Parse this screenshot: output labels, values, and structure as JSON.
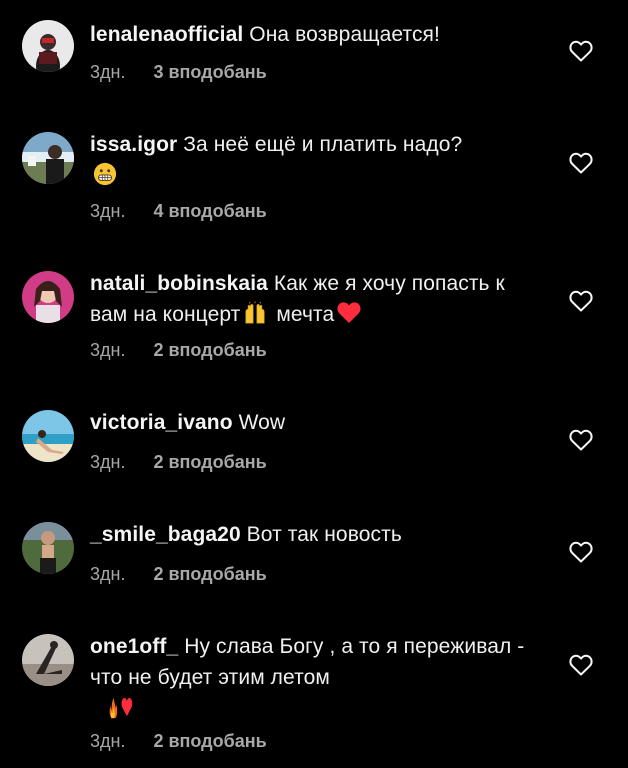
{
  "comments": [
    {
      "username": "lenalenaofficial",
      "text": "Она возвращается!",
      "time": "3дн.",
      "likes": "3 вподобань",
      "avatar_icon": "user-avatar-icon"
    },
    {
      "username": "issa.igor",
      "text": "За неё ещё и платить надо?",
      "emoji_after": "grimacing-face-emoji",
      "time": "3дн.",
      "likes": "4 вподобань",
      "avatar_icon": "user-avatar-icon"
    },
    {
      "username": "natali_bobinskaia",
      "text": "Как же я хочу попасть к вам на концерт",
      "text_after": " мечта",
      "emoji_inline": "raising-hands-emoji",
      "emoji_after": "red-heart-emoji",
      "time": "3дн.",
      "likes": "2 вподобань",
      "avatar_icon": "user-avatar-icon"
    },
    {
      "username": "victoria_ivano",
      "text": "Wow",
      "time": "3дн.",
      "likes": "2 вподобань",
      "avatar_icon": "user-avatar-icon"
    },
    {
      "username": "_smile_baga20",
      "text": "Вот так новость",
      "time": "3дн.",
      "likes": "2 вподобань",
      "avatar_icon": "user-avatar-icon"
    },
    {
      "username": "one1off_",
      "text": "Ну слава Богу , а то я переживал - что не будет этим летом",
      "emoji_after": "fire-and-red-heart-emoji",
      "time": "3дн.",
      "likes": "2 вподобань",
      "avatar_icon": "user-avatar-icon"
    }
  ],
  "colors": {
    "background": "#000000",
    "text": "#f5f5f5",
    "meta": "#a8a8a8",
    "heart": "#ff2d3d"
  },
  "icons": {
    "like": "heart-outline-icon"
  }
}
